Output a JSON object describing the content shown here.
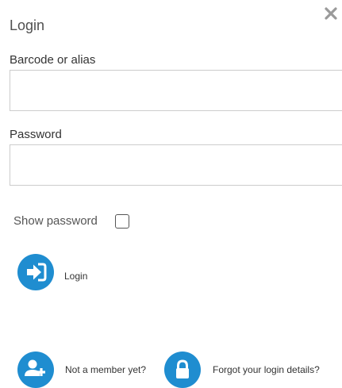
{
  "dialog": {
    "title": "Login",
    "close_icon": "close-icon"
  },
  "fields": {
    "barcode": {
      "label": "Barcode or alias",
      "value": "",
      "placeholder": ""
    },
    "password": {
      "label": "Password",
      "value": "",
      "placeholder": ""
    }
  },
  "show_password": {
    "label": "Show password",
    "checked": false
  },
  "actions": {
    "login": {
      "label": "Login",
      "icon": "sign-in-icon"
    },
    "register": {
      "label": "Not a member yet?",
      "icon": "add-user-icon"
    },
    "forgot": {
      "label": "Forgot your login details?",
      "icon": "lock-icon"
    }
  },
  "colors": {
    "accent": "#1f8dd0",
    "close_icon": "#9a9a9a"
  }
}
